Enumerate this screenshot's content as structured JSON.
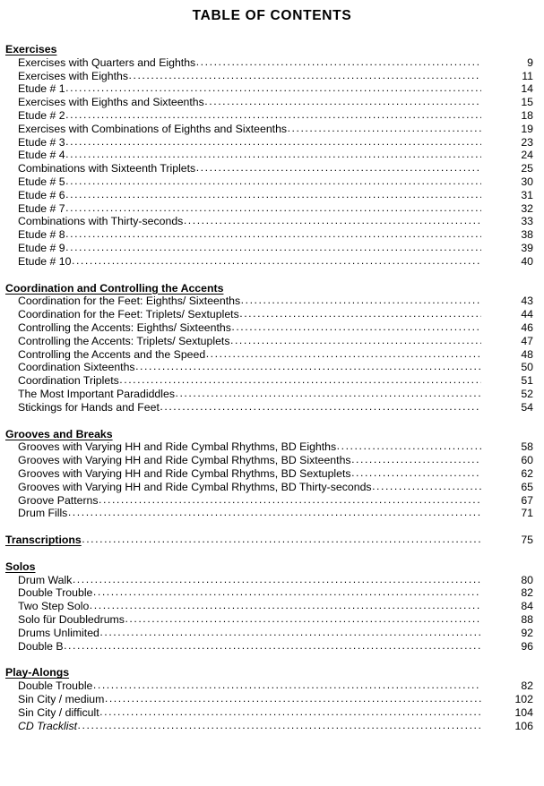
{
  "document": {
    "title": "TABLE OF CONTENTS"
  },
  "sections": [
    {
      "heading": "Exercises",
      "heading_page": null,
      "entries": [
        {
          "title": "Exercises with Quarters and Eighths",
          "page": "9"
        },
        {
          "title": "Exercises with Eighths",
          "page": "11"
        },
        {
          "title": "Etude # 1",
          "page": "14"
        },
        {
          "title": "Exercises with Eighths and Sixteenths",
          "page": "15"
        },
        {
          "title": "Etude # 2",
          "page": "18"
        },
        {
          "title": "Exercises with Combinations of Eighths and Sixteenths",
          "page": "19"
        },
        {
          "title": "Etude # 3",
          "page": "23"
        },
        {
          "title": "Etude # 4",
          "page": "24"
        },
        {
          "title": "Combinations with Sixteenth Triplets",
          "page": "25"
        },
        {
          "title": "Etude # 5",
          "page": "30"
        },
        {
          "title": "Etude # 6",
          "page": "31"
        },
        {
          "title": "Etude # 7",
          "page": "32"
        },
        {
          "title": "Combinations with Thirty-seconds",
          "page": "33"
        },
        {
          "title": "Etude # 8",
          "page": "38"
        },
        {
          "title": "Etude # 9",
          "page": "39"
        },
        {
          "title": "Etude # 10",
          "page": "40"
        }
      ]
    },
    {
      "heading": "Coordination and Controlling the Accents",
      "heading_page": null,
      "entries": [
        {
          "title": "Coordination for the Feet: Eighths/ Sixteenths",
          "page": "43"
        },
        {
          "title": "Coordination for the Feet: Triplets/ Sextuplets",
          "page": "44"
        },
        {
          "title": "Controlling the Accents: Eighths/ Sixteenths",
          "page": "46"
        },
        {
          "title": "Controlling the Accents: Triplets/ Sextuplets",
          "page": "47"
        },
        {
          "title": "Controlling the Accents and the Speed",
          "page": "48"
        },
        {
          "title": "Coordination Sixteenths",
          "page": "50"
        },
        {
          "title": "Coordination Triplets",
          "page": "51"
        },
        {
          "title": "The Most Important Paradiddles",
          "page": "52"
        },
        {
          "title": "Stickings for Hands and Feet",
          "page": "54"
        }
      ]
    },
    {
      "heading": "Grooves and Breaks",
      "heading_page": null,
      "entries": [
        {
          "title": "Grooves with Varying HH and Ride Cymbal Rhythms, BD Eighths",
          "page": "58"
        },
        {
          "title": "Grooves with Varying HH and Ride Cymbal Rhythms, BD Sixteenths",
          "page": "60"
        },
        {
          "title": "Grooves with Varying HH and Ride Cymbal Rhythms, BD Sextuplets",
          "page": "62"
        },
        {
          "title": "Grooves with Varying HH and Ride Cymbal Rhythms, BD Thirty-seconds",
          "page": "65"
        },
        {
          "title": "Groove Patterns",
          "page": "67"
        },
        {
          "title": "Drum Fills",
          "page": "71"
        }
      ]
    },
    {
      "heading": "Transcriptions",
      "heading_page": "75",
      "entries": []
    },
    {
      "heading": "Solos",
      "heading_page": null,
      "entries": [
        {
          "title": "Drum Walk",
          "page": "80"
        },
        {
          "title": "Double Trouble",
          "page": "82"
        },
        {
          "title": "Two Step Solo",
          "page": "84"
        },
        {
          "title": "Solo für Doubledrums",
          "page": "88"
        },
        {
          "title": "Drums Unlimited",
          "page": "92"
        },
        {
          "title": "Double B",
          "page": "96"
        }
      ]
    },
    {
      "heading": "Play-Alongs",
      "heading_page": null,
      "entries": [
        {
          "title": "Double Trouble",
          "page": "82"
        },
        {
          "title": "Sin City / medium",
          "page": "102"
        },
        {
          "title": "Sin City / difficult",
          "page": "104"
        },
        {
          "title": "CD Tracklist",
          "page": "106",
          "italic": true
        }
      ]
    }
  ]
}
